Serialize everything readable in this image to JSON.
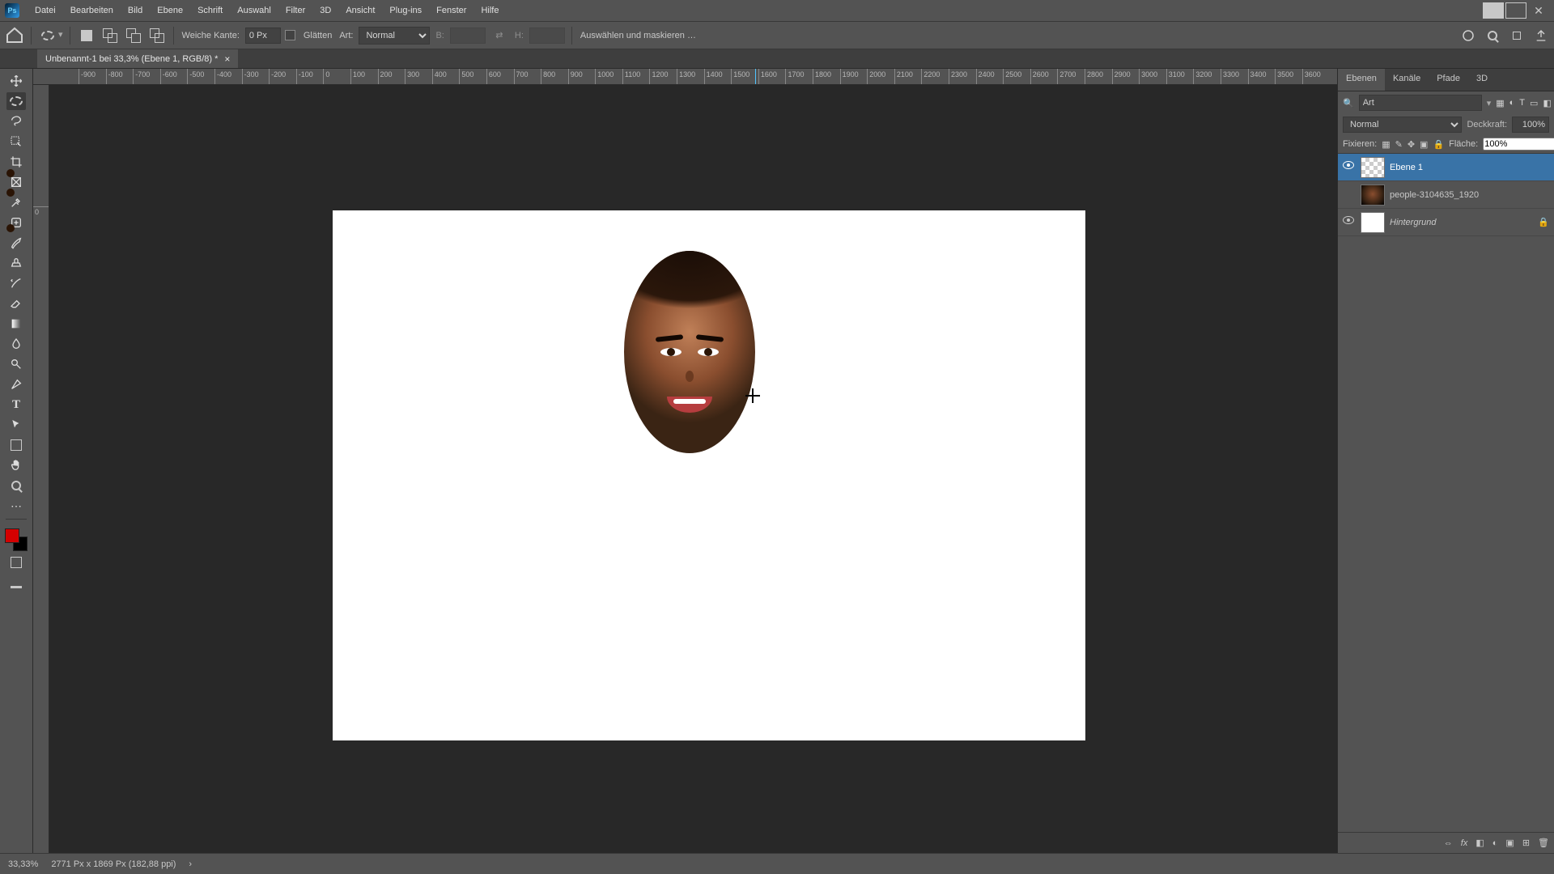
{
  "app": {
    "logo_text": "Ps"
  },
  "menu": [
    "Datei",
    "Bearbeiten",
    "Bild",
    "Ebene",
    "Schrift",
    "Auswahl",
    "Filter",
    "3D",
    "Ansicht",
    "Plug-ins",
    "Fenster",
    "Hilfe"
  ],
  "options_bar": {
    "feather_label": "Weiche Kante:",
    "feather_value": "0 Px",
    "antialias_label": "Glätten",
    "style_label": "Art:",
    "style_value": "Normal",
    "width_label": "B:",
    "width_value": "",
    "height_label": "H:",
    "height_value": "",
    "select_and_mask": "Auswählen und maskieren …"
  },
  "document_tab": {
    "title": "Unbenannt-1 bei 33,3% (Ebene 1, RGB/8) *"
  },
  "ruler_h": [
    "-900",
    "-800",
    "-700",
    "-600",
    "-500",
    "-400",
    "-300",
    "-200",
    "-100",
    "0",
    "100",
    "200",
    "300",
    "400",
    "500",
    "600",
    "700",
    "800",
    "900",
    "1000",
    "1100",
    "1200",
    "1300",
    "1400",
    "1500",
    "1600",
    "1700",
    "1800",
    "1900",
    "2000",
    "2100",
    "2200",
    "2300",
    "2400",
    "2500",
    "2600",
    "2700",
    "2800",
    "2900",
    "3000",
    "3100",
    "3200",
    "3300",
    "3400",
    "3500",
    "3600"
  ],
  "ruler_v": [
    "0"
  ],
  "panels": {
    "tabs": [
      "Ebenen",
      "Kanäle",
      "Pfade",
      "3D"
    ],
    "search_placeholder": "Art",
    "blend_mode": "Normal",
    "opacity_label": "Deckkraft:",
    "opacity_value": "100%",
    "lock_label": "Fixieren:",
    "fill_label": "Fläche:",
    "fill_value": "100%",
    "layers": [
      {
        "name": "Ebene 1",
        "visible": true,
        "thumb": "checker",
        "selected": true,
        "italic": false,
        "locked": false
      },
      {
        "name": "people-3104635_1920",
        "visible": false,
        "thumb": "img-face",
        "selected": false,
        "italic": false,
        "locked": false
      },
      {
        "name": "Hintergrund",
        "visible": true,
        "thumb": "white",
        "selected": false,
        "italic": true,
        "locked": true
      }
    ]
  },
  "status": {
    "zoom": "33,33%",
    "doc_info": "2771 Px x 1869 Px (182,88 ppi)"
  }
}
